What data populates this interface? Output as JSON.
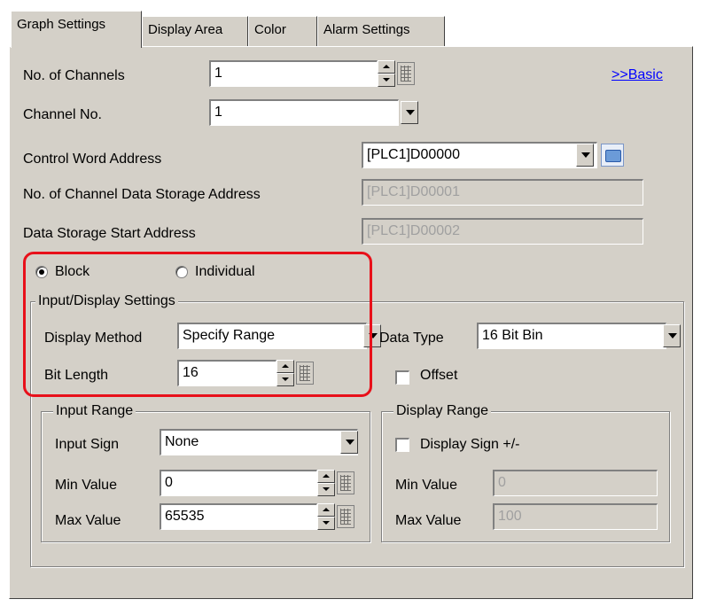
{
  "tabs": [
    "Graph Settings",
    "Display Area",
    "Color",
    "Alarm Settings"
  ],
  "basic_link": ">>Basic",
  "channels": {
    "label": "No. of Channels",
    "value": "1"
  },
  "channel_no": {
    "label": "Channel No.",
    "value": "1"
  },
  "control_word": {
    "label": "Control Word Address",
    "value": "[PLC1]D00000"
  },
  "data_storage_addr": {
    "label": "No. of Channel Data Storage Address",
    "value": "[PLC1]D00001"
  },
  "storage_start": {
    "label": "Data Storage Start Address",
    "value": "[PLC1]D00002"
  },
  "mode": {
    "block": "Block",
    "individual": "Individual",
    "selected": "Block"
  },
  "input_display": {
    "title": "Input/Display Settings",
    "display_method": {
      "label": "Display Method",
      "value": "Specify Range"
    },
    "data_type": {
      "label": "Data Type",
      "value": "16 Bit Bin"
    },
    "bit_length": {
      "label": "Bit Length",
      "value": "16"
    },
    "offset": {
      "label": "Offset",
      "checked": false
    }
  },
  "input_range": {
    "title": "Input Range",
    "sign": {
      "label": "Input Sign",
      "value": "None"
    },
    "min": {
      "label": "Min Value",
      "value": "0"
    },
    "max": {
      "label": "Max Value",
      "value": "65535"
    }
  },
  "display_range": {
    "title": "Display Range",
    "sign": {
      "label": "Display Sign +/-",
      "checked": false
    },
    "min": {
      "label": "Min Value",
      "value": "0"
    },
    "max": {
      "label": "Max Value",
      "value": "100"
    }
  },
  "colors": {
    "highlight": "#e8101a",
    "panel": "#d4d0c8",
    "link": "#0000ff"
  }
}
